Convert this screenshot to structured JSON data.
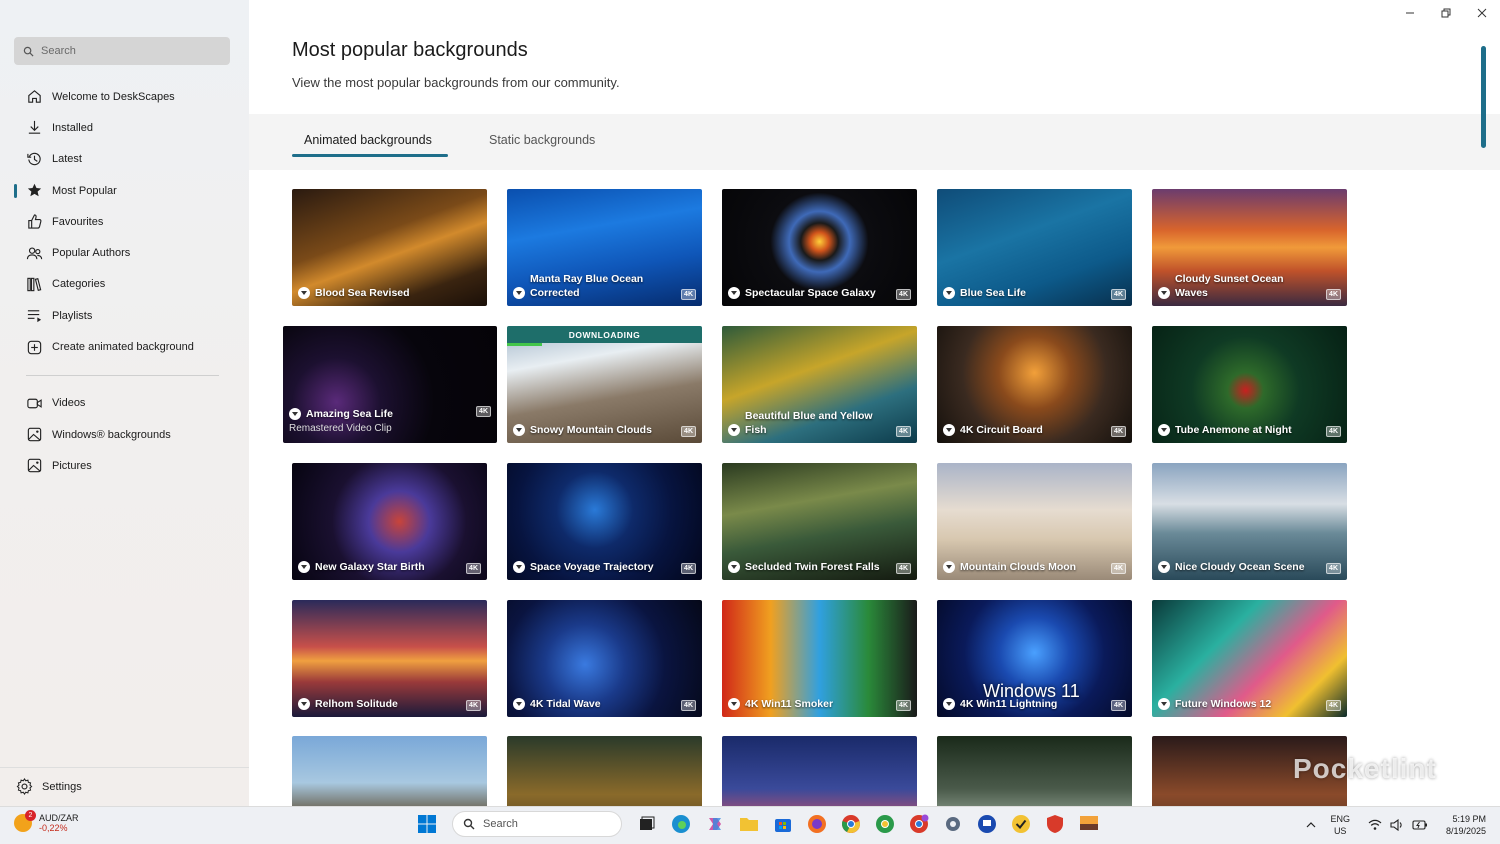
{
  "sidebar": {
    "search_placeholder": "Search",
    "items": [
      {
        "label": "Welcome to DeskScapes",
        "icon": "home-icon"
      },
      {
        "label": "Installed",
        "icon": "download-icon"
      },
      {
        "label": "Latest",
        "icon": "history-icon"
      },
      {
        "label": "Most Popular",
        "icon": "star-icon",
        "active": true
      },
      {
        "label": "Favourites",
        "icon": "thumbs-up-icon"
      },
      {
        "label": "Popular Authors",
        "icon": "people-icon"
      },
      {
        "label": "Categories",
        "icon": "library-icon"
      },
      {
        "label": "Playlists",
        "icon": "playlist-icon"
      },
      {
        "label": "Create animated background",
        "icon": "add-square-icon"
      }
    ],
    "items2": [
      {
        "label": "Videos",
        "icon": "video-icon"
      },
      {
        "label": "Windows® backgrounds",
        "icon": "image-icon"
      },
      {
        "label": "Pictures",
        "icon": "picture-icon"
      }
    ],
    "settings_label": "Settings"
  },
  "header": {
    "title": "Most popular backgrounds",
    "subtitle": "View the most popular backgrounds from our community."
  },
  "tabs": [
    {
      "label": "Animated backgrounds",
      "active": true
    },
    {
      "label": "Static backgrounds",
      "active": false
    }
  ],
  "badge_text": "4K",
  "tiles": [
    {
      "title": "Blood Sea Revised",
      "badge": false,
      "bg": "linear-gradient(160deg,#2a1a10 0%,#7a4a18 40%,#d28a2c 55%,#3a2410 80%,#1a0f08 100%)"
    },
    {
      "title": "Manta Ray Blue Ocean Corrected",
      "badge": true,
      "bg": "linear-gradient(170deg,#0a4fae 0%,#1c7ae0 35%,#0f56b8 65%,#062c6e 100%)"
    },
    {
      "title": "Spectacular Space Galaxy",
      "badge": true,
      "bg": "radial-gradient(circle at 50% 45%,#ffcf3a 0%,#d1541b 8%,#1a1a1a 16%,#3f6ab8 26%,#0c0c10 42%,#050507 100%)"
    },
    {
      "title": "Blue Sea Life",
      "badge": true,
      "bg": "linear-gradient(160deg,#0f4c78 0%,#1a74a4 40%,#0d5a8a 70%,#082f4c 100%)"
    },
    {
      "title": "Cloudy Sunset Ocean Waves",
      "badge": true,
      "bg": "linear-gradient(180deg,#6b3c6e 0%,#d8642c 35%,#f09a3a 50%,#c0522a 70%,#3b2a40 100%)"
    },
    {
      "title": "Amazing Sea Life",
      "badge": true,
      "sub": "Remastered Video Clip",
      "big": true,
      "bg": "radial-gradient(circle at 25% 65%,#5a2a7a 0%,#1c1030 25%,#07050c 55%,#050308 100%)"
    },
    {
      "title": "Snowy Mountain Clouds",
      "badge": true,
      "downloading": true,
      "progress": 0.18,
      "bg": "linear-gradient(170deg,#9fb4c8 0%,#e8eef2 30%,#8a7a68 60%,#5a4a38 100%)"
    },
    {
      "title": "Beautiful Blue and Yellow Fish",
      "badge": true,
      "bg": "linear-gradient(160deg,#2e5a3a 0%,#c7a52a 40%,#2d6f7e 70%,#0c3a4a 100%)"
    },
    {
      "title": "4K Circuit Board",
      "badge": true,
      "bg": "radial-gradient(circle at 50% 40%,#f2a03a 0%,#8a4a1c 30%,#3a2a20 60%,#14100c 100%)"
    },
    {
      "title": "Tube Anemone at Night",
      "badge": true,
      "bg": "radial-gradient(circle at 48% 55%,#c82020 0%,#2e6a2a 15%,#0f3a24 45%,#062014 100%)"
    },
    {
      "title": "New Galaxy Star Birth",
      "badge": true,
      "bg": "radial-gradient(circle at 55% 50%,#c8443a 0%,#4a3a9a 25%,#1a1030 55%,#060410 100%)"
    },
    {
      "title": "Space Voyage Trajectory",
      "badge": true,
      "bg": "radial-gradient(circle at 45% 40%,#2a7ad8 0%,#0e2a6a 30%,#071440 60%,#02061a 100%)"
    },
    {
      "title": "Secluded Twin Forest Falls",
      "badge": true,
      "bg": "linear-gradient(170deg,#2a3a20 0%,#7a8a4a 35%,#3a5a3a 60%,#141a10 100%)"
    },
    {
      "title": "Mountain Clouds Moon",
      "badge": true,
      "bg": "linear-gradient(180deg,#aab4c8 0%,#e6dcd0 40%,#d8c8b0 65%,#9a8a78 100%)"
    },
    {
      "title": "Nice Cloudy Ocean Scene",
      "badge": true,
      "bg": "linear-gradient(180deg,#8aa4c0 0%,#d8dee4 35%,#6a8a98 60%,#2a4a5a 100%)"
    },
    {
      "title": "Relhom Solitude",
      "badge": true,
      "bg": "linear-gradient(180deg,#2a2a5a 0%,#c8504a 40%,#f0a040 52%,#9a3a3a 70%,#1a1a3a 100%)"
    },
    {
      "title": "4K Tidal Wave",
      "badge": true,
      "bg": "radial-gradient(circle at 40% 55%,#3a7ae0 0%,#1a3a8a 30%,#0a1440 60%,#050818 100%)"
    },
    {
      "title": "4K Win11 Smoker",
      "badge": true,
      "bg": "linear-gradient(90deg,#d02818 0%,#f0a020 25%,#30a0e0 50%,#2a8a3a 75%,#1a1a1a 100%)"
    },
    {
      "title": "4K Win11 Lightning",
      "badge": true,
      "overlay": "Windows 11",
      "bg": "radial-gradient(circle at 50% 45%,#4aa0ff 0%,#1a4ab0 30%,#0a1a5a 60%,#040a28 100%)"
    },
    {
      "title": "Future Windows 12",
      "badge": true,
      "bg": "linear-gradient(135deg,#0a3a3a 0%,#2ab0a0 35%,#e05a8a 60%,#f0c030 80%,#0a2a2a 100%)"
    },
    {
      "title": "",
      "badge": false,
      "partial": true,
      "bg": "linear-gradient(180deg,#7aa8d8 0%,#a8c8e0 40%,#5a4a30 70%,#2a5a7a 100%)"
    },
    {
      "title": "",
      "badge": false,
      "partial": true,
      "bg": "linear-gradient(180deg,#2a3a2a 0%,#8a6a2a 50%,#3a3020 100%)"
    },
    {
      "title": "",
      "badge": false,
      "partial": true,
      "bg": "linear-gradient(180deg,#1a2a6a 0%,#3a4a9a 45%,#c0506a 75%,#1a1a3a 100%)"
    },
    {
      "title": "",
      "badge": false,
      "partial": true,
      "bg": "linear-gradient(180deg,#1a2a1a 0%,#4a5a4a 45%,#8a9a8a 70%,#1a2a1a 100%)"
    },
    {
      "title": "",
      "badge": false,
      "partial": true,
      "bg": "linear-gradient(180deg,#2a1a1a 0%,#8a4a2a 50%,#3a2a20 100%)"
    }
  ],
  "downloading_text": "DOWNLOADING",
  "watermark": "Pocketlint",
  "taskbar": {
    "ticker_symbol": "AUD/ZAR",
    "ticker_change": "-0,22%",
    "ticker_count": "2",
    "search_label": "Search",
    "lang_top": "ENG",
    "lang_bottom": "US",
    "time": "5:19 PM",
    "date": "8/19/2025"
  },
  "colors": {
    "accent": "#1e6e8a",
    "download_banner": "#1e6e6a",
    "progress": "#43c64a"
  }
}
